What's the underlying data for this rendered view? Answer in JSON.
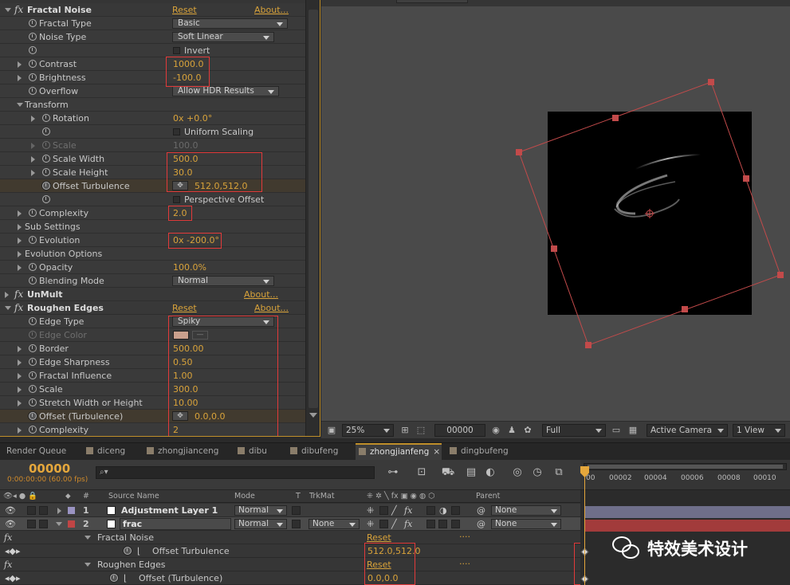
{
  "effects": {
    "fractal_noise": {
      "name": "Fractal Noise",
      "reset": "Reset",
      "about": "About...",
      "fractal_type": {
        "label": "Fractal Type",
        "value": "Basic"
      },
      "noise_type": {
        "label": "Noise Type",
        "value": "Soft Linear"
      },
      "invert": {
        "label": "Invert"
      },
      "contrast": {
        "label": "Contrast",
        "value": "1000.0"
      },
      "brightness": {
        "label": "Brightness",
        "value": "-100.0"
      },
      "overflow": {
        "label": "Overflow",
        "value": "Allow HDR Results"
      },
      "transform": {
        "label": "Transform"
      },
      "rotation": {
        "label": "Rotation",
        "value": "0x +0.0°"
      },
      "uniform_scaling": {
        "label": "Uniform Scaling"
      },
      "scale": {
        "label": "Scale",
        "value": "100.0"
      },
      "scale_width": {
        "label": "Scale Width",
        "value": "500.0"
      },
      "scale_height": {
        "label": "Scale Height",
        "value": "30.0"
      },
      "offset_turbulence": {
        "label": "Offset Turbulence",
        "value": "512.0,512.0"
      },
      "perspective_offset": {
        "label": "Perspective Offset"
      },
      "complexity": {
        "label": "Complexity",
        "value": "2.0"
      },
      "sub_settings": {
        "label": "Sub Settings"
      },
      "evolution": {
        "label": "Evolution",
        "value": "0x -200.0°"
      },
      "evolution_options": {
        "label": "Evolution Options"
      },
      "opacity": {
        "label": "Opacity",
        "value": "100.0%"
      },
      "blending_mode": {
        "label": "Blending Mode",
        "value": "Normal"
      }
    },
    "unmult": {
      "name": "UnMult",
      "about": "About..."
    },
    "roughen_edges": {
      "name": "Roughen Edges",
      "reset": "Reset",
      "about": "About...",
      "edge_type": {
        "label": "Edge Type",
        "value": "Spiky"
      },
      "edge_color": {
        "label": "Edge Color",
        "color": "#c9a08d"
      },
      "border": {
        "label": "Border",
        "value": "500.00"
      },
      "edge_sharpness": {
        "label": "Edge Sharpness",
        "value": "0.50"
      },
      "fractal_influence": {
        "label": "Fractal Influence",
        "value": "1.00"
      },
      "scale": {
        "label": "Scale",
        "value": "300.0"
      },
      "stretch": {
        "label": "Stretch Width or Height",
        "value": "10.00"
      },
      "offset": {
        "label": "Offset (Turbulence)",
        "value": "0.0,0.0"
      },
      "complexity": {
        "label": "Complexity",
        "value": "2"
      }
    }
  },
  "viewer": {
    "zoom": "25%",
    "timecode": "00000",
    "resolution": "Full",
    "camera": "Active Camera",
    "views": "1 View"
  },
  "tabs": [
    {
      "label": "Render Queue"
    },
    {
      "label": "diceng"
    },
    {
      "label": "zhongjianceng"
    },
    {
      "label": "dibu"
    },
    {
      "label": "dibufeng"
    },
    {
      "label": "zhongjianfeng",
      "active": true
    },
    {
      "label": "dingbufeng"
    }
  ],
  "timeline": {
    "timecode": "00000",
    "timecode_sub": "0:00:00:00 (60.00 fps)",
    "search_placeholder": "⌕▾",
    "columns": {
      "num": "#",
      "source_name": "Source Name",
      "mode": "Mode",
      "t": "T",
      "trkmat": "TrkMat",
      "parent": "Parent"
    },
    "ruler_ticks": [
      "00",
      "00002",
      "00004",
      "00006",
      "00008",
      "00010"
    ],
    "layers": [
      {
        "num": "1",
        "name": "Adjustment Layer 1",
        "mode": "Normal",
        "trkmat": "",
        "parent": "None",
        "label_color": "#9a93c2"
      },
      {
        "num": "2",
        "name": "frac",
        "mode": "Normal",
        "trkmat": "None",
        "parent": "None",
        "label_color": "#c04545"
      }
    ],
    "sub_rows": {
      "fractal_noise": {
        "label": "Fractal Noise",
        "reset": "Reset",
        "dots": "...."
      },
      "offset_turbulence": {
        "label": "Offset Turbulence",
        "value": "512.0,512.0"
      },
      "roughen_edges": {
        "label": "Roughen Edges",
        "reset": "Reset",
        "dots": "...."
      },
      "offset_turbulence2": {
        "label": "Offset (Turbulence)",
        "value": "0.0,0.0"
      }
    }
  },
  "watermark": {
    "text": "特效美术设计"
  },
  "colors": {
    "accent": "#d9a33a",
    "highlight_box": "#e23a3a",
    "bounding_box": "#c24a4a"
  }
}
